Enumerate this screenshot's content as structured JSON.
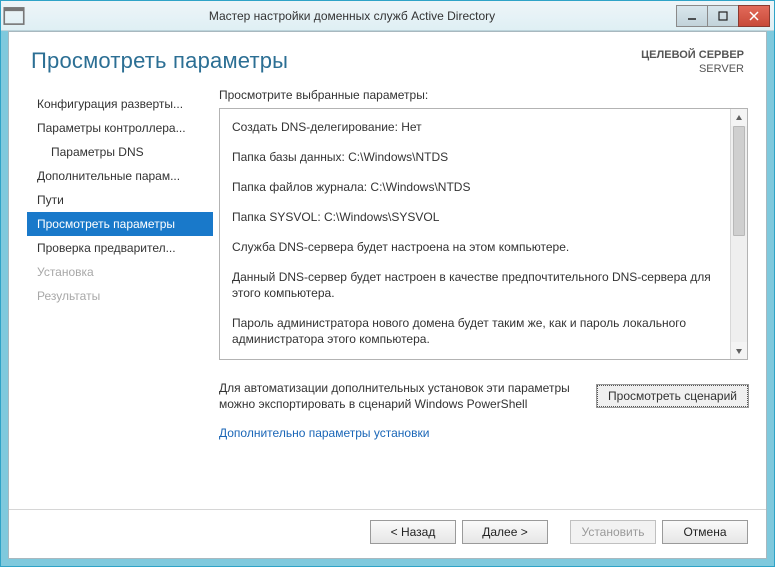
{
  "window": {
    "title": "Мастер настройки доменных служб Active Directory"
  },
  "header": {
    "title": "Просмотреть параметры",
    "target_label": "ЦЕЛЕВОЙ СЕРВЕР",
    "target_value": "SERVER"
  },
  "nav": {
    "items": [
      {
        "label": "Конфигурация разверты...",
        "state": "normal"
      },
      {
        "label": "Параметры контроллера...",
        "state": "normal"
      },
      {
        "label": "Параметры DNS",
        "state": "normal",
        "indent": true
      },
      {
        "label": "Дополнительные парам...",
        "state": "normal"
      },
      {
        "label": "Пути",
        "state": "normal"
      },
      {
        "label": "Просмотреть параметры",
        "state": "selected"
      },
      {
        "label": "Проверка предварител...",
        "state": "normal"
      },
      {
        "label": "Установка",
        "state": "disabled"
      },
      {
        "label": "Результаты",
        "state": "disabled"
      }
    ]
  },
  "main": {
    "review_label": "Просмотрите выбранные параметры:",
    "lines": [
      "Создать DNS-делегирование: Нет",
      "Папка базы данных: C:\\Windows\\NTDS",
      "Папка файлов журнала: C:\\Windows\\NTDS",
      "Папка SYSVOL: C:\\Windows\\SYSVOL",
      "Служба DNS-сервера будет настроена на этом компьютере.",
      "Данный DNS-сервер будет настроен в качестве предпочтительного DNS-сервера для этого компьютера.",
      "Пароль администратора нового домена будет таким же, как и пароль локального администратора этого компьютера."
    ],
    "export_text": "Для автоматизации дополнительных установок эти параметры можно экспортировать в сценарий Windows PowerShell",
    "view_script_label": "Просмотреть сценарий",
    "more_link": "Дополнительно параметры установки"
  },
  "footer": {
    "back": "< Назад",
    "next": "Далее >",
    "install": "Установить",
    "cancel": "Отмена"
  }
}
